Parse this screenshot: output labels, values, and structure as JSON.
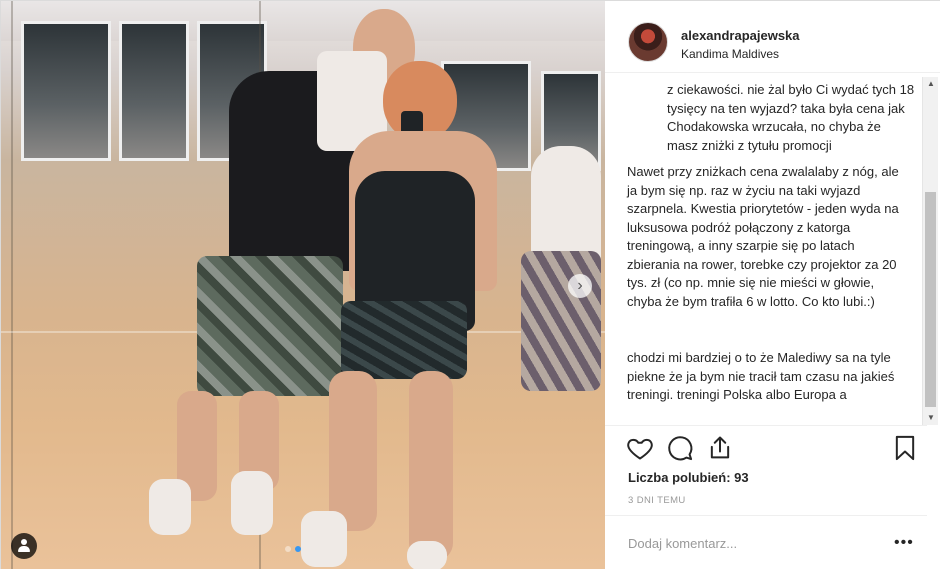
{
  "post": {
    "username": "alexandrapajewska",
    "location": "Kandima Maldives",
    "likes_text": "Liczba polubień: 93",
    "time_ago": "3 DNI TEMU",
    "comment_placeholder": "Dodaj komentarz..."
  },
  "comments": [
    "z ciekawości. nie żal było Ci wydać tych 18 tysięcy na ten wyjazd? taka była cena jak Chodakowska wrzucała, no chyba że masz zniżki z tytułu promocji",
    "Nawet przy zniżkach cena zwalalaby z nóg, ale ja bym się np. raz w życiu na taki wyjazd szarpnela. Kwestia priorytetów - jeden wyda na luksusowa podróż połączony z katorga treningową, a inny szarpie się po latach zbierania na rower, torebke czy projektor za 20 tys. zł (co np. mnie się nie mieści w głowie, chyba że bym trafiła 6 w lotto. Co kto lubi.:)",
    "chodzi mi bardziej o to że Malediwy sa na tyle piekne że ja bym nie tracił tam czasu na jakieś treningi. treningi Polska albo Europa a"
  ],
  "carousel": {
    "count": 2,
    "active_index": 1
  },
  "icons": {
    "like": "heart-icon",
    "comment": "speech-bubble-icon",
    "share": "share-icon",
    "save": "bookmark-icon",
    "next": "chevron-right-icon",
    "tag": "user-tag-icon",
    "more": "more-options-icon"
  },
  "colors": {
    "text": "#262626",
    "muted": "#999999",
    "border": "#efefef",
    "accent": "#3897f0"
  }
}
